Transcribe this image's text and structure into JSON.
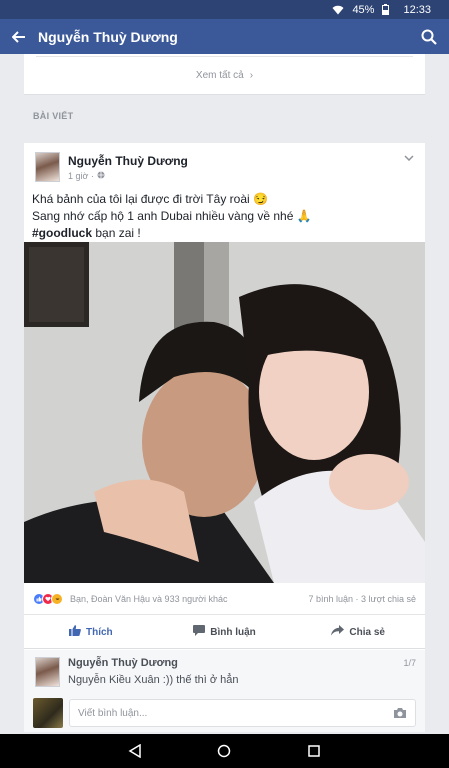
{
  "status_bar": {
    "battery": "45%",
    "time": "12:33"
  },
  "app_bar": {
    "title": "Nguyễn Thuỳ Dương"
  },
  "card_top": {
    "see_all": "Xem tất cả",
    "see_all_arrow": "›"
  },
  "section": {
    "label": "BÀI VIẾT"
  },
  "post": {
    "author": "Nguyễn Thuỳ Dương",
    "time": "1 giờ ·",
    "line1": "Khá bảnh của tôi lại được đi trời Tây roài 😏",
    "line2": "Sang nhớ cấp hộ 1 anh Dubai nhiều vàng về nhé 🙏",
    "hashtag": "#goodluck",
    "line3_rest": " bạn zai !",
    "reactions_text": "Bạn, Đoàn Văn Hậu và 933 người khác",
    "counts": "7 bình luận · 3 lượt chia sẻ"
  },
  "actions": {
    "like": "Thích",
    "comment": "Bình luận",
    "share": "Chia sẻ"
  },
  "comment": {
    "author": "Nguyễn Thuỳ Dương",
    "text": "Nguyễn Kiều Xuân :)) thế thì ở hẳn",
    "page": "1/7",
    "placeholder": "Viết bình luận..."
  },
  "colors": {
    "facebook_blue": "#3b5998",
    "status_blue": "#2d4373",
    "like_blue": "#4267b2"
  },
  "icons": [
    "wifi-icon",
    "battery-icon",
    "back-arrow-icon",
    "search-icon",
    "chevron-down-icon",
    "globe-icon",
    "like-icon",
    "comment-icon",
    "share-icon",
    "camera-icon",
    "nav-back-icon",
    "nav-home-icon",
    "nav-recents-icon"
  ]
}
